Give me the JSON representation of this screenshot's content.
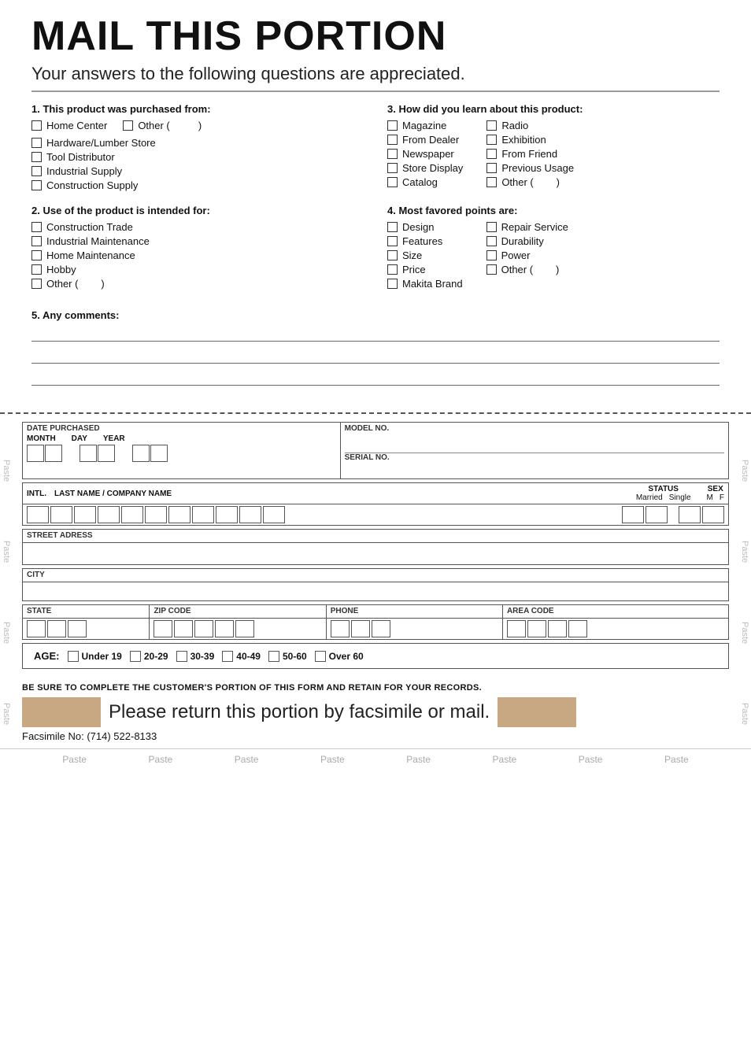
{
  "title": "MAIL THIS PORTION",
  "subtitle": "Your answers to the following questions are appreciated.",
  "q1": {
    "label": "1. This product was purchased from:",
    "items": [
      {
        "text": "Home Center"
      },
      {
        "text": "Other (",
        "has_paren": true
      },
      {
        "text": "Hardware/Lumber Store"
      },
      {
        "text": "Tool Distributor"
      },
      {
        "text": "Industrial Supply"
      },
      {
        "text": "Construction Supply"
      }
    ]
  },
  "q2": {
    "label": "2. Use of the product is intended for:",
    "items": [
      {
        "text": "Construction Trade"
      },
      {
        "text": "Industrial Maintenance"
      },
      {
        "text": "Home Maintenance"
      },
      {
        "text": "Hobby"
      },
      {
        "text": "Other (",
        "has_paren": true
      }
    ]
  },
  "q3": {
    "label": "3. How did you learn about this product:",
    "col1": [
      "Magazine",
      "From Dealer",
      "Newspaper",
      "Store Display",
      "Catalog"
    ],
    "col2": [
      "Radio",
      "Exhibition",
      "From Friend",
      "Previous Usage",
      "Other ("
    ]
  },
  "q4": {
    "label": "4. Most favored points are:",
    "col1": [
      "Design",
      "Features",
      "Size",
      "Price",
      "Makita Brand"
    ],
    "col2": [
      "Repair Service",
      "Durability",
      "Power",
      "Other ("
    ]
  },
  "q5": {
    "label": "5. Any comments:"
  },
  "form": {
    "date_purchased": "DATE PURCHASED",
    "month": "MONTH",
    "day": "DAY",
    "year": "YEAR",
    "model_no": "MODEL NO.",
    "serial_no": "SERIAL NO.",
    "intl": "INTL.",
    "last_name": "LAST NAME / COMPANY NAME",
    "status": "STATUS",
    "married": "Married",
    "single": "Single",
    "sex": "SEX",
    "m": "M",
    "f": "F",
    "street": "STREET ADRESS",
    "city": "CITY",
    "state": "STATE",
    "zip": "ZIP CODE",
    "phone": "PHONE",
    "area_code": "AREA CODE",
    "age_label": "AGE:",
    "age_options": [
      "Under 19",
      "20-29",
      "30-39",
      "40-49",
      "50-60",
      "Over 60"
    ]
  },
  "retain_text": "BE SURE TO COMPLETE THE CUSTOMER'S PORTION OF THIS FORM AND RETAIN FOR YOUR RECORDS.",
  "return_text": "Please return this portion by facsimile or mail.",
  "fax": "Facsimile No: (714) 522-8133",
  "paste_labels": [
    "Paste",
    "Paste",
    "Paste",
    "Paste",
    "Paste",
    "Paste",
    "Paste",
    "Paste"
  ],
  "side_paste": "Paste"
}
